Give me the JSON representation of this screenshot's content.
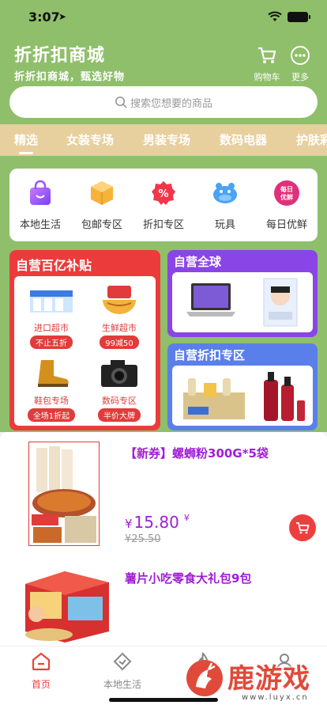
{
  "status": {
    "time": "3:07"
  },
  "header": {
    "title": "折折扣商城",
    "subtitle": "折折扣商城，甄选好物",
    "cart_label": "购物车",
    "more_label": "更多"
  },
  "search": {
    "placeholder": "搜索您想要的商品"
  },
  "tabs": [
    "精选",
    "女装专场",
    "男装专场",
    "数码电器",
    "护肤彩"
  ],
  "categories": [
    {
      "label": "本地生活",
      "icon": "shopping-bag-icon"
    },
    {
      "label": "包邮专区",
      "icon": "package-box-icon"
    },
    {
      "label": "折扣专区",
      "icon": "discount-badge-icon"
    },
    {
      "label": "玩具",
      "icon": "toy-hippo-icon"
    },
    {
      "label": "每日优鲜",
      "icon": "daily-fresh-icon",
      "badge_top": "每日",
      "badge_bottom": "优鲜"
    }
  ],
  "panels": {
    "subsidy": {
      "title": "自营百亿补贴",
      "items": [
        {
          "name": "进口超市",
          "badge": "不止五折"
        },
        {
          "name": "生鲜超市",
          "badge": "99减50"
        },
        {
          "name": "鞋包专场",
          "badge": "全场1折起"
        },
        {
          "name": "数码专区",
          "badge": "半价大牌"
        }
      ]
    },
    "global": {
      "title": "自营全球"
    },
    "discount": {
      "title": "自营折扣专区"
    }
  },
  "products": [
    {
      "title": "【新券】螺蛳粉300G*5袋",
      "currency": "¥",
      "price": "15.80",
      "currency_suffix": "¥",
      "old_price": "¥25.50"
    },
    {
      "title": "薯片小吃零食大礼包9包"
    }
  ],
  "tabbar": [
    {
      "label": "首页",
      "active": true
    },
    {
      "label": "本地生活",
      "active": false
    }
  ],
  "watermark": {
    "text": "鹿游戏",
    "url": "www.luyx.cn"
  },
  "colors": {
    "header_green": "#8fbf6a",
    "tab_gold": "#e8cf9e",
    "accent_red": "#ec3b3b",
    "product_purple": "#a01ed6"
  }
}
